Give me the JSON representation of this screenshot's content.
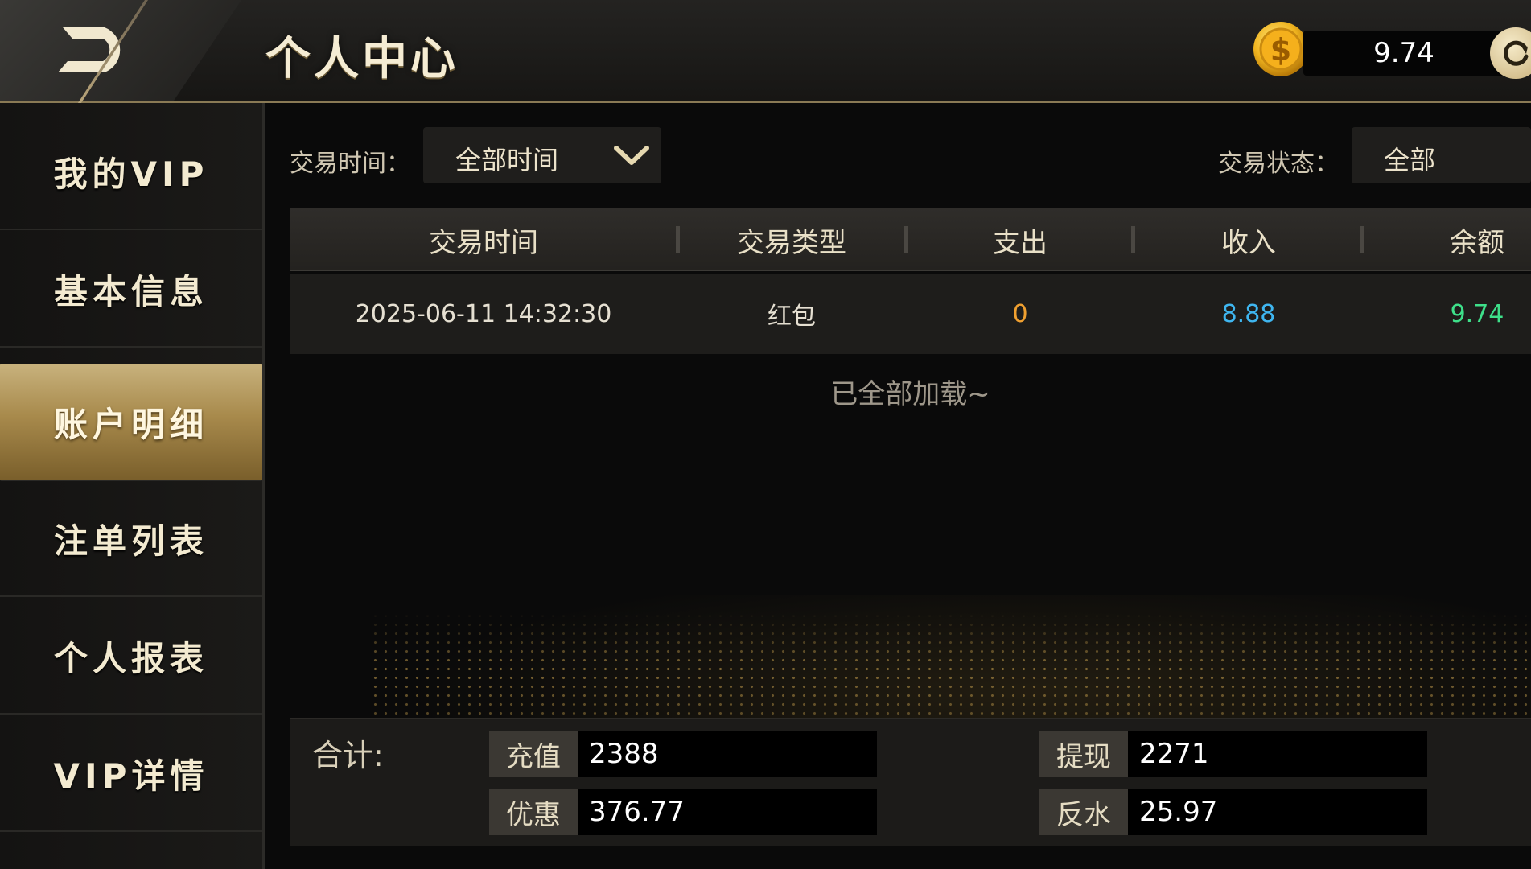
{
  "header": {
    "title": "个人中心",
    "balance": "9.74",
    "back_icon": "back-arrow-icon",
    "coin_icon": "dollar-coin-icon",
    "refresh_icon": "refresh-icon"
  },
  "sidebar": {
    "items": [
      {
        "label": "我的VIP",
        "active": false
      },
      {
        "label": "基本信息",
        "active": false
      },
      {
        "label": "账户明细",
        "active": true
      },
      {
        "label": "注单列表",
        "active": false
      },
      {
        "label": "个人报表",
        "active": false
      },
      {
        "label": "VIP详情",
        "active": false
      }
    ]
  },
  "filters": {
    "time_label": "交易时间：",
    "time_value": "全部时间",
    "status_label": "交易状态：",
    "status_value": "全部"
  },
  "table": {
    "headers": [
      "交易时间",
      "交易类型",
      "支出",
      "收入",
      "余额"
    ],
    "rows": [
      {
        "time": "2025-06-11 14:32:30",
        "type": "红包",
        "expense": "0",
        "income": "8.88",
        "balance": "9.74"
      }
    ],
    "end_message": "已全部加载~"
  },
  "totals": {
    "label": "合计:",
    "recharge_label": "充值",
    "recharge_value": "2388",
    "withdraw_label": "提现",
    "withdraw_value": "2271",
    "discount_label": "优惠",
    "discount_value": "376.77",
    "rebate_label": "反水",
    "rebate_value": "25.97"
  },
  "colors": {
    "accent_gold": "#c8b27d",
    "expense": "#f0a030",
    "income": "#3fb6f0",
    "balance": "#3ee08a"
  }
}
